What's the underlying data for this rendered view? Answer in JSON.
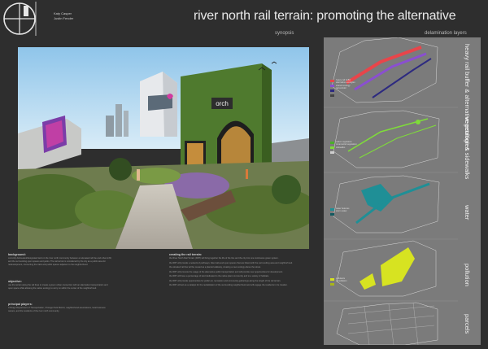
{
  "header": {
    "authors": [
      "Katy Casper",
      "Justin Fender"
    ],
    "title": "river north rail terrain: promoting the alternative",
    "synopsis_label": "synopsis",
    "delamination_label": "delamination layers"
  },
  "hero": {
    "sign_text": "orch"
  },
  "left_column": {
    "background_heading": "background:",
    "background_text": "currently delineated/designated land on the river north community between an elevated rail line and urban infill, and the surrounding open spaces and parks. The rail terrain is considered by the city as a public area for redevelopment, connecting the trails and public spaces adjacent to the neighborhood.",
    "objective_heading": "objective:",
    "objective_text": "use the terrain along the rail lines to create a green urban connection with an alternative transportation and open space while allowing the native ecology to carry on within the center of the neighborhood.",
    "players_heading": "principal players:",
    "players_text": "Chicago Department of Transportation, Chicago Park District, neighborhood associations, local business owners, and the residents of the river north community."
  },
  "right_column": {
    "heading": "creating the rail terrain:",
    "paragraphs": [
      "the River North Rail Terrain (RRT) will bring together the life of the line and the city into one continuous green system.",
      "the RRT will provide a network of pathways, bike trails and open spaces that are linked with the surrounding area and neighborhood.",
      "the elevated rail line will be reused as a planted walkway, creating a new ecology above the street.",
      "the RRT will promote the usage of the alternative public transportation and will provide new opportunities for development.",
      "the RRT will have a percentage of land dedicated to the native plant community and to a variety of habitats.",
      "the RRT will provide opportunities for public art, recreation and community gatherings along the length of the rail terrain.",
      "the RRT will act as a catalyst for the revitalization of the surrounding neighborhood and will engage the residents in its creation."
    ]
  },
  "layers": [
    {
      "label": "heavy rail buffer & alternative ecologies",
      "legend": [
        "heavy rail buffer",
        "alternative ecologies",
        "shared ecology",
        "rail corridor"
      ]
    },
    {
      "label": "vegetation & sidewalks",
      "legend": [
        "native vegetation",
        "ornamental vegetation",
        "sidewalks"
      ]
    },
    {
      "label": "water",
      "legend": [
        "water features",
        "storm water"
      ]
    },
    {
      "label": "pollution",
      "legend": [
        "pollutants",
        "remediation"
      ]
    },
    {
      "label": "parcels",
      "legend": []
    }
  ],
  "colors": {
    "background": "#2e2e2e",
    "panel": "#7b7b7b",
    "rail_red": "#e8454a",
    "rail_purple": "#8a4fd0",
    "vegetation_green": "#7fdc3a",
    "water_teal": "#1f8f96",
    "pollution_yellow": "#d7e321"
  }
}
